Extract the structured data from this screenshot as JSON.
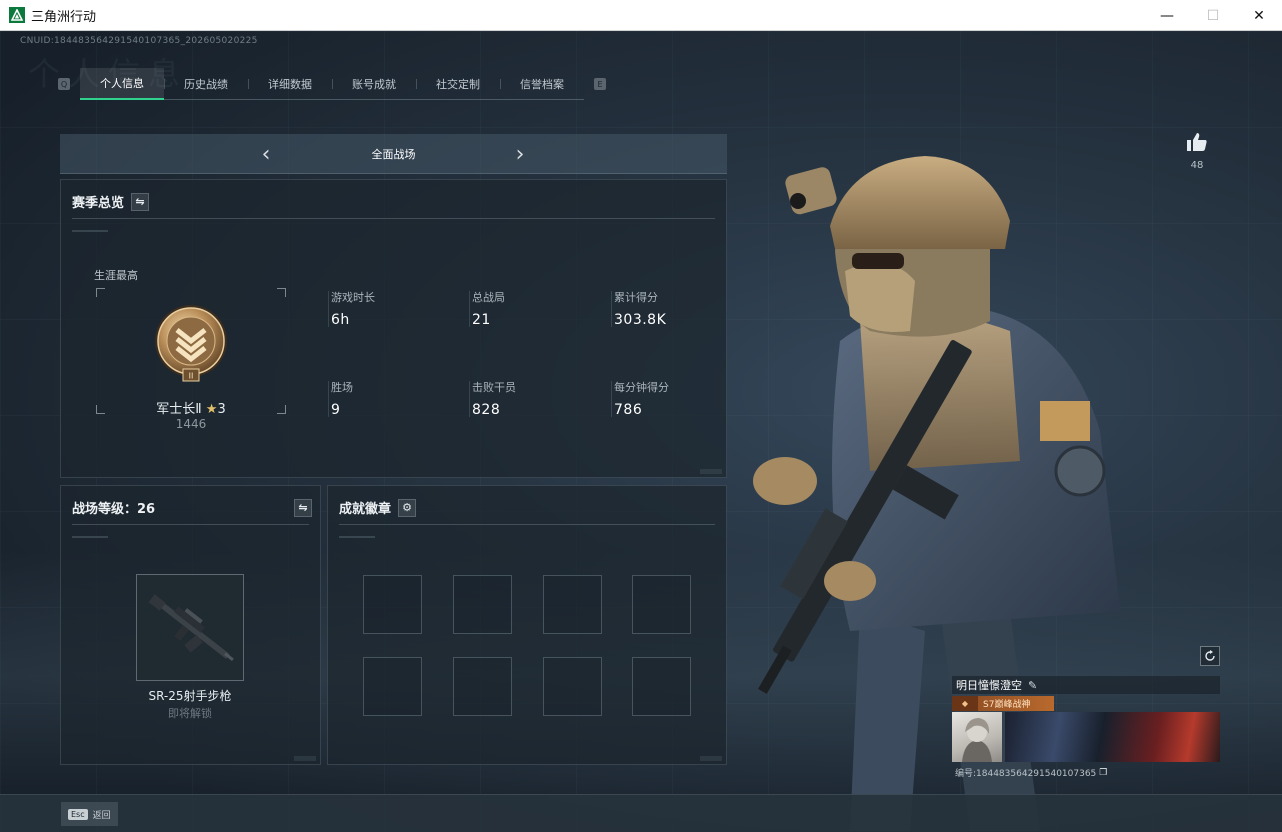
{
  "window": {
    "title": "三角洲行动",
    "minimize": "—",
    "maximize": "☐",
    "close": "✕"
  },
  "header": {
    "uid": "CNUID:1844835642915401073​65_202605020225",
    "ghost_title": "个人信息"
  },
  "tabs": [
    {
      "label": "个人信息",
      "active": true
    },
    {
      "label": "历史战绩",
      "active": false
    },
    {
      "label": "详细数据",
      "active": false
    },
    {
      "label": "账号成就",
      "active": false
    },
    {
      "label": "社交定制",
      "active": false
    },
    {
      "label": "信誉档案",
      "active": false
    }
  ],
  "tab_keys": {
    "left": "Q",
    "right": "E"
  },
  "mode": {
    "label": "全面战场",
    "prev": "‹",
    "next": "›"
  },
  "season": {
    "title": "赛季总览",
    "switch_icon": "⇋",
    "career_label": "生涯最高",
    "rank_name": "军士长Ⅱ",
    "rank_star": "★",
    "rank_stars": "3",
    "rank_score": "1446",
    "stats": [
      {
        "label": "游戏时长",
        "value": "6h"
      },
      {
        "label": "总战局",
        "value": "21"
      },
      {
        "label": "累计得分",
        "value": "303.8K"
      },
      {
        "label": "胜场",
        "value": "9"
      },
      {
        "label": "击败干员",
        "value": "828"
      },
      {
        "label": "每分钟得分",
        "value": "786"
      }
    ]
  },
  "battlefield": {
    "title": "战场等级：26",
    "switch_icon": "⇋",
    "weapon_name": "SR-25射手步枪",
    "weapon_status": "即将解锁"
  },
  "achievements": {
    "title": "成就徽章",
    "settings_icon": "⚙",
    "slots": 8
  },
  "like": {
    "count": "48"
  },
  "player": {
    "name": "明日憧憬澄空",
    "title": "S7巅峰战神",
    "id_label": "编号:18448356429154010736​5"
  },
  "bottom": {
    "esc_key": "Esc",
    "esc_label": "返回"
  },
  "colors": {
    "accent": "#2fd38e",
    "background": "#1b2530",
    "title_badge": "#b8692d"
  }
}
